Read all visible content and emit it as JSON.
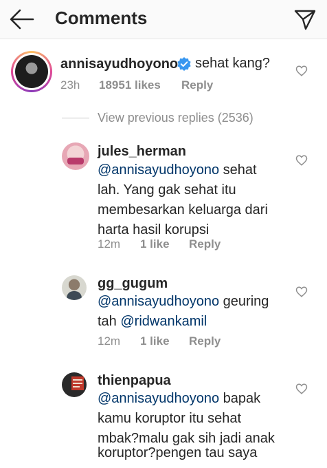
{
  "header": {
    "title": "Comments"
  },
  "main_comment": {
    "username": "annisayudhoyono",
    "text": "sehat kang?",
    "time": "23h",
    "likes": "18951 likes",
    "reply": "Reply"
  },
  "view_previous": "View previous replies (2536)",
  "replies": [
    {
      "username": "jules_herman",
      "mention": "@annisayudhoyono",
      "line1_rest": " sehat",
      "lines": [
        "lah. Yang gak sehat itu",
        "membesarkan keluarga dari",
        "harta hasil korupsi"
      ],
      "time": "12m",
      "likes": "1 like",
      "reply": "Reply"
    },
    {
      "username": "gg_gugum",
      "mention": "@annisayudhoyono",
      "line1_rest": " geuring",
      "line2_prefix": "tah ",
      "mention2": "@ridwankamil",
      "time": "12m",
      "likes": "1 like",
      "reply": "Reply"
    },
    {
      "username": "thienpapua",
      "mention": "@annisayudhoyono",
      "line1_rest": " bapak",
      "lines": [
        "kamu koruptor itu sehat",
        "mbak?malu gak sih jadi anak",
        "koruptor?pengen tau saya"
      ]
    }
  ],
  "icons": {
    "back": "arrow-left-icon",
    "send": "paper-plane-icon",
    "verified": "verified-badge-icon",
    "like": "heart-outline-icon"
  },
  "colors": {
    "mention": "#003569",
    "verified": "#3897f0",
    "meta": "#8e8e8e"
  }
}
